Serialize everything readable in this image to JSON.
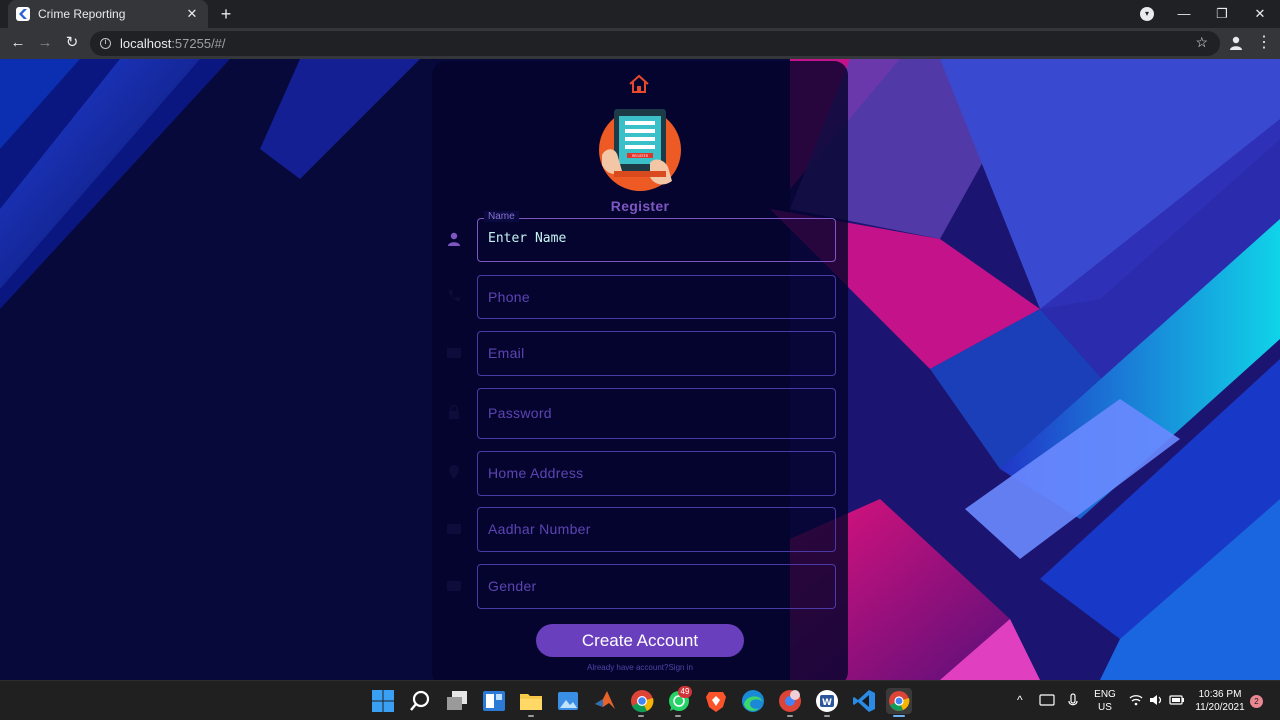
{
  "browser": {
    "tab_title": "Crime Reporting",
    "tab_close": "✕",
    "new_tab": "+",
    "url_host": "localhost",
    "url_rest": ":57255/#/",
    "minimize": "—",
    "maximize": "❐",
    "close": "✕"
  },
  "register": {
    "title": "Register",
    "fields": [
      {
        "label": "Name",
        "value": "Enter Name",
        "icon": "person-icon",
        "focused": true
      },
      {
        "placeholder": "Phone",
        "icon": "phone-icon"
      },
      {
        "placeholder": "Email",
        "icon": "email-icon"
      },
      {
        "placeholder": "Password",
        "icon": "lock-icon"
      },
      {
        "placeholder": "Home Address",
        "icon": "location-icon"
      },
      {
        "placeholder": "Aadhar Number",
        "icon": "id-card-icon"
      },
      {
        "placeholder": "Gender",
        "icon": "gender-icon"
      }
    ],
    "create_button": "Create Account",
    "signin_text": "Already have account?Sign in",
    "logo_caption": "REGISTER"
  },
  "taskbar": {
    "whatsapp_badge": "49",
    "lang_top": "ENG",
    "lang_bottom": "US",
    "time": "10:36 PM",
    "date": "11/20/2021",
    "notification_count": "2"
  },
  "colors": {
    "accent": "#6a3fbe",
    "label": "#7e57c2",
    "field_border": "#4a3aa8",
    "home_icon": "#e64a2e"
  }
}
